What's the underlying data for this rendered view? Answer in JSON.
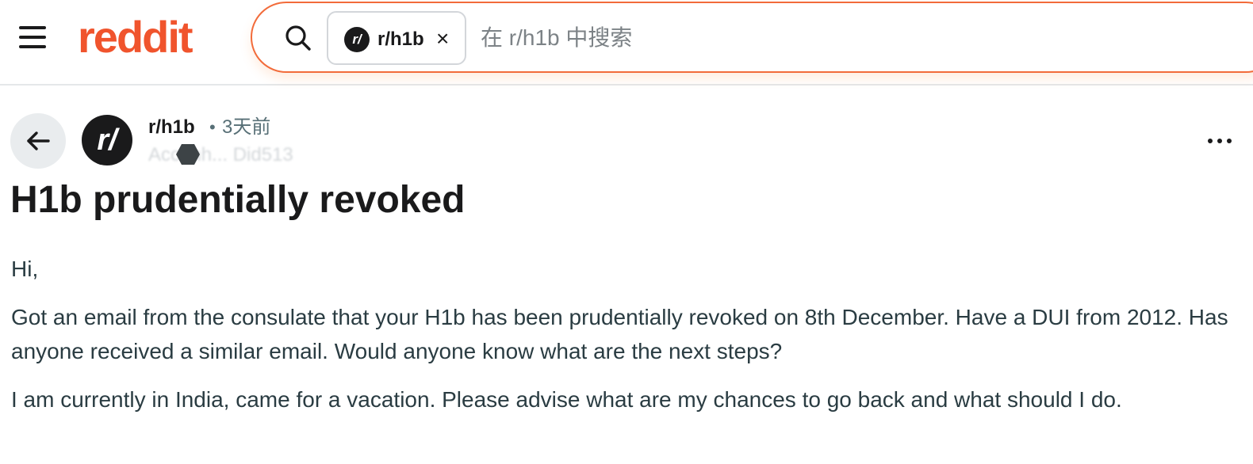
{
  "header": {
    "logo_text": "reddit",
    "brand_color": "#f0542d",
    "menu_icon": "hamburger-menu-icon",
    "search": {
      "icon": "search-icon",
      "chip": {
        "avatar_text": "r/",
        "label": "r/h1b",
        "close_glyph": "×"
      },
      "placeholder": "在 r/h1b 中搜索"
    }
  },
  "post": {
    "back_icon": "arrow-left-icon",
    "subreddit_avatar_text": "r/",
    "subreddit": "r/h1b",
    "separator": "•",
    "time_ago": "3天前",
    "author_blurred": "Accenh... Did513",
    "more_icon": "more-horizontal-icon",
    "title": "H1b prudentially revoked",
    "body": [
      "Hi,",
      "Got an email from the consulate that your H1b has been prudentially revoked on 8th December. Have a DUI from 2012. Has anyone received a similar email. Would anyone know what are the next steps?",
      "I am currently in India, came for a vacation. Please advise what are my chances to go back and what should I do."
    ]
  }
}
